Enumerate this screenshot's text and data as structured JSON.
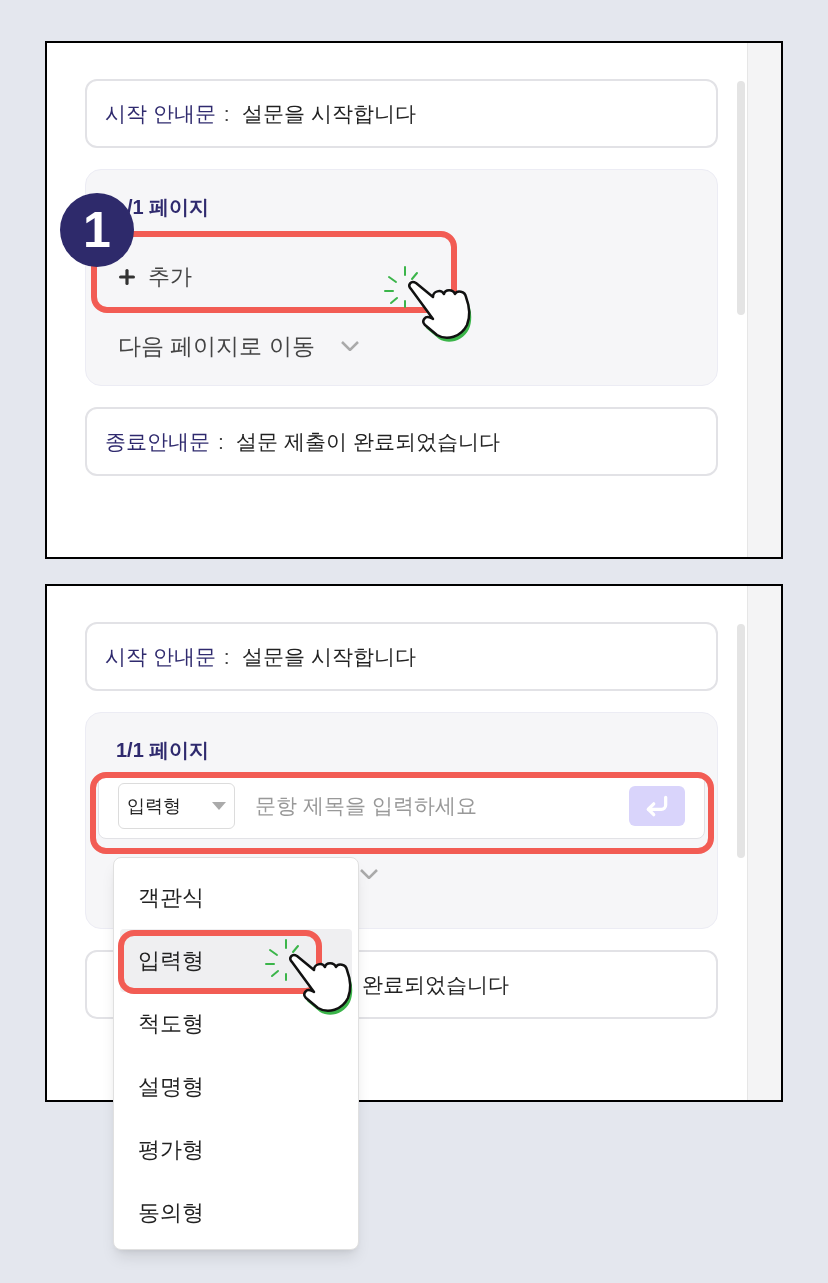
{
  "panels": [
    {
      "kind": "add",
      "step_badge": "1",
      "start_notice": {
        "label": "시작 안내문",
        "separator": ":",
        "value": "설문을 시작합니다"
      },
      "page": {
        "title": "/1 페이지",
        "add_label": "추가",
        "next_action": "다음 페이지로 이동"
      },
      "end_notice": {
        "label": "종료안내문",
        "separator": ":",
        "value": "설문 제출이 완료되었습니다"
      }
    },
    {
      "kind": "input",
      "start_notice": {
        "label": "시작 안내문",
        "separator": ":",
        "value": "설문을 시작합니다"
      },
      "page": {
        "title": "1/1 페이지",
        "type_select": "입력형",
        "placeholder": "문항 제목을 입력하세요"
      },
      "end_notice": {
        "value": "완료되었습니다"
      },
      "type_menu": [
        {
          "label": "객관식",
          "selected": false
        },
        {
          "label": "입력형",
          "selected": true
        },
        {
          "label": "척도형",
          "selected": false
        },
        {
          "label": "설명형",
          "selected": false
        },
        {
          "label": "평가형",
          "selected": false
        },
        {
          "label": "동의형",
          "selected": false
        }
      ]
    }
  ]
}
